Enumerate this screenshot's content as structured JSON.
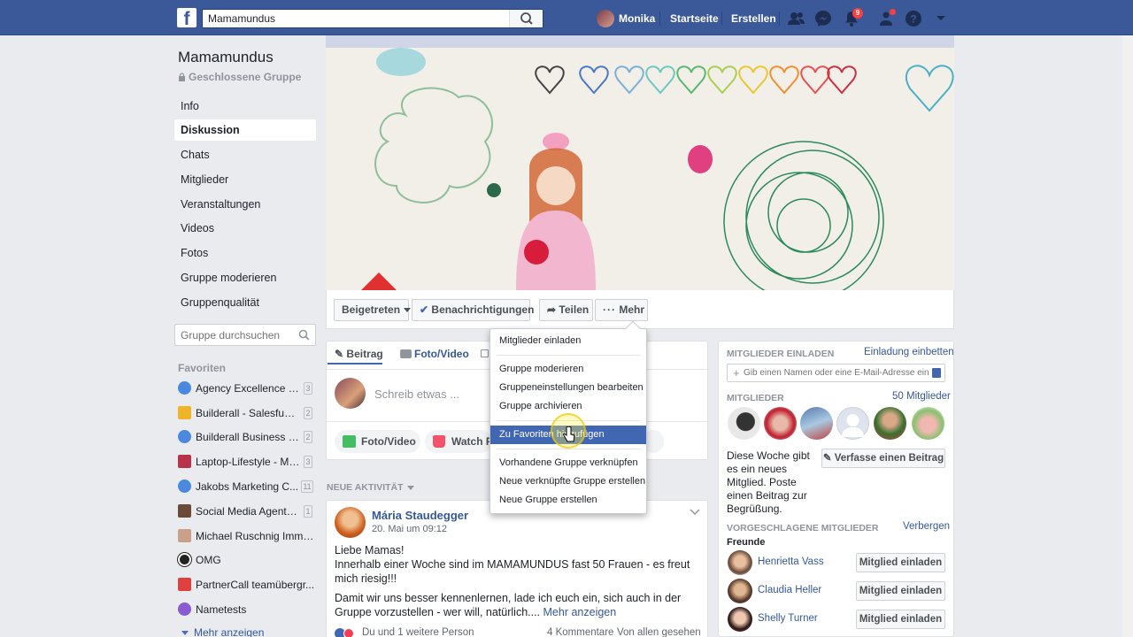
{
  "topbar": {
    "logo": "f",
    "search_value": "Mamamundus",
    "user_name": "Monika",
    "home": "Startseite",
    "create": "Erstellen",
    "notification_count": "9"
  },
  "group": {
    "name": "Mamamundus",
    "privacy": "Geschlossene Gruppe"
  },
  "left_nav": [
    "Info",
    "Diskussion",
    "Chats",
    "Mitglieder",
    "Veranstaltungen",
    "Videos",
    "Fotos",
    "Gruppe moderieren",
    "Gruppenqualität"
  ],
  "group_search_placeholder": "Gruppe durchsuchen",
  "favorites": {
    "title": "Favoriten",
    "items": [
      {
        "label": "Agency Excellence 2...",
        "count": "3"
      },
      {
        "label": "Builderall - Salesfunn...",
        "count": "2"
      },
      {
        "label": "Builderall Business - ...",
        "count": "2"
      },
      {
        "label": "Laptop-Lifestyle - Mo...",
        "count": "3"
      },
      {
        "label": "Jakobs Marketing C...",
        "count": "11"
      },
      {
        "label": "Social Media Agentu...",
        "count": "1"
      },
      {
        "label": "Michael Ruschnig Immo...",
        "count": ""
      },
      {
        "label": "OMG",
        "count": ""
      },
      {
        "label": "PartnerCall teamübergr...",
        "count": ""
      },
      {
        "label": "Nametests",
        "count": ""
      }
    ],
    "more": "Mehr anzeigen"
  },
  "cover_buttons": {
    "joined": "Beigetreten",
    "notifications": "Benachrichtigungen",
    "share": "Teilen",
    "more": "Mehr"
  },
  "composer": {
    "tab_post": "Beitrag",
    "tab_photo": "Foto/Video",
    "placeholder": "Schreib etwas ...",
    "pill_photo": "Foto/Video",
    "pill_watch": "Watch Pa"
  },
  "activity_header": "NEUE AKTIVITÄT",
  "post": {
    "author": "Mária Staudegger",
    "date": "20. Mai um 09:12",
    "line1": "Liebe Mamas!",
    "line2": "Innerhalb einer Woche sind im MAMAMUNDUS fast 50 Frauen - es freut",
    "line3": "mich riesig!!!",
    "line4": "Damit wir uns besser kennenlernen, lade ich euch ein, sich auch in der",
    "line5": "Gruppe vorzustellen - wer will, natürlich....",
    "see_more": "Mehr anzeigen",
    "reactions": "Du und 1 weitere Person",
    "comments": "4 Kommentare",
    "seen": "Von allen gesehen"
  },
  "dropdown": {
    "items": [
      "Mitglieder einladen",
      "Gruppe moderieren",
      "Gruppeneinstellungen bearbeiten",
      "Gruppe archivieren",
      "Zu Favoriten hinzufügen",
      "Vorhandene Gruppe verknüpfen",
      "Neue verknüpfte Gruppe erstellen",
      "Neue Gruppe erstellen"
    ]
  },
  "right": {
    "invite_title": "MITGLIEDER EINLADEN",
    "invite_link": "Einladung einbetten",
    "invite_placeholder": "Gib einen Namen oder eine E-Mail-Adresse ein ...",
    "members_title": "MITGLIEDER",
    "members_count": "50 Mitglieder",
    "week_text_1": "Diese Woche gibt",
    "week_text_2": "es ein neues",
    "week_text_3": "Mitglied. Poste",
    "week_text_4": "einen Beitrag zur",
    "week_text_5": "Begrüßung.",
    "write_post": "Verfasse einen Beitrag",
    "suggested_title": "VORGESCHLAGENE MITGLIEDER",
    "hide": "Verbergen",
    "friends": "Freunde",
    "suggested": [
      {
        "name": "Henrietta Vass",
        "button": "Mitglied einladen"
      },
      {
        "name": "Claudia Heller",
        "button": "Mitglied einladen"
      },
      {
        "name": "Shelly Turner",
        "button": "Mitglied einladen"
      }
    ]
  },
  "colors": {
    "brand": "#3b5998",
    "link": "#365899",
    "menu_highlight": "#4267b2",
    "notification_badge": "#fa3e3e"
  }
}
